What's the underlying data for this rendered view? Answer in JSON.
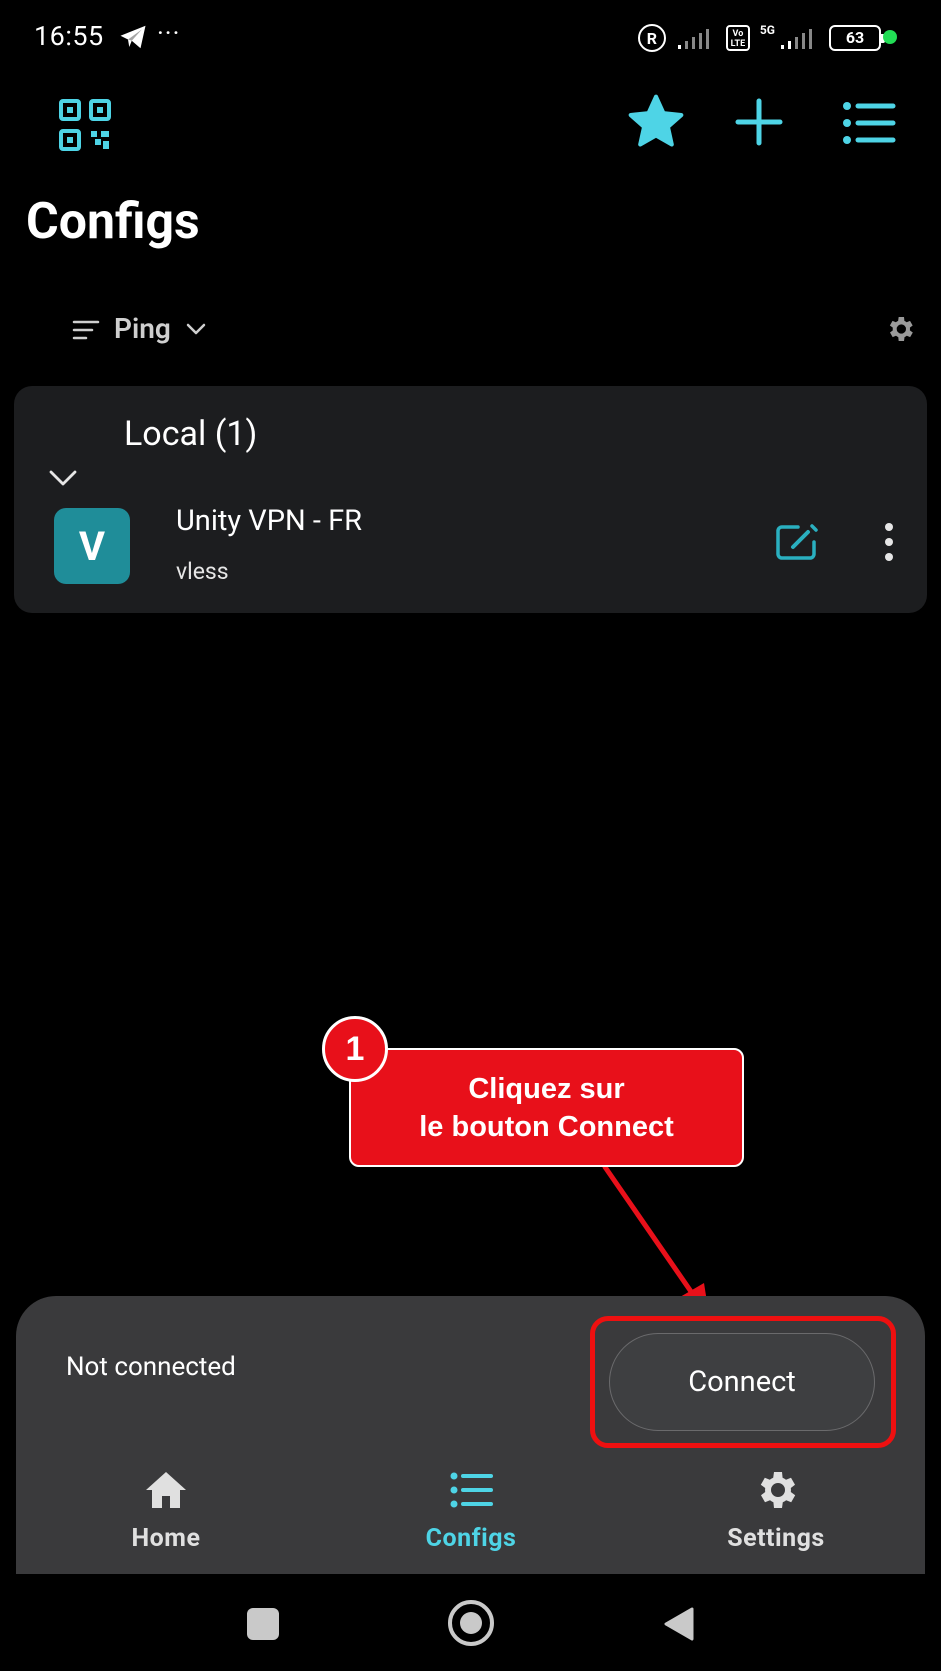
{
  "status_bar": {
    "time": "16:55",
    "more": "···",
    "registered": "R",
    "volte": "Vo LTE",
    "network": "5G",
    "battery": "63"
  },
  "header": {
    "title": "Configs"
  },
  "sort": {
    "label": "Ping"
  },
  "group": {
    "title": "Local (1)",
    "configs": [
      {
        "initial": "V",
        "name": "Unity VPN - FR",
        "protocol": "vless"
      }
    ]
  },
  "callout": {
    "number": "1",
    "line1": "Cliquez sur",
    "line2": "le bouton Connect"
  },
  "connection": {
    "status": "Not connected",
    "button_label": "Connect"
  },
  "bottom_nav": {
    "items": [
      {
        "label": "Home",
        "icon": "home-icon"
      },
      {
        "label": "Configs",
        "icon": "list-icon",
        "active": true
      },
      {
        "label": "Settings",
        "icon": "gear-icon"
      }
    ]
  },
  "colors": {
    "accent": "#4ed4e6",
    "avatar": "#1f8d99",
    "annotation": "#e8101a",
    "card": "#1c1d1f",
    "panel": "#3a3a3c"
  }
}
